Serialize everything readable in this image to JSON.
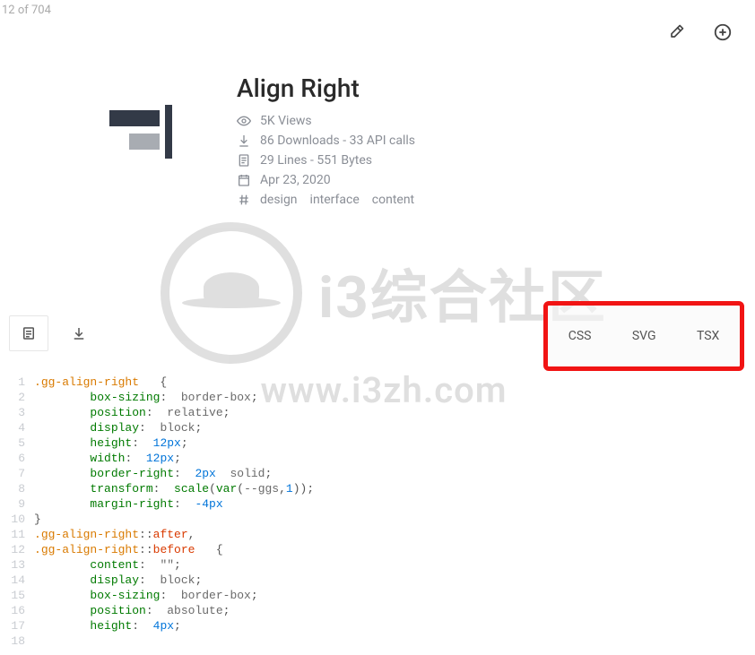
{
  "counter": "12 of 704",
  "header": {
    "title": "Align Right",
    "views": "5K Views",
    "downloads": "86 Downloads - 33 API calls",
    "lines": "29 Lines - 551 Bytes",
    "date": "Apr 23, 2020",
    "tags": [
      "design",
      "interface",
      "content"
    ]
  },
  "format_tabs": [
    "CSS",
    "SVG",
    "TSX"
  ],
  "watermark": {
    "label": "i3综合社区",
    "url": "www.i3zh.com"
  },
  "code": {
    "lines": [
      {
        "n": 1,
        "t": [
          [
            ".",
            "sel"
          ],
          [
            "gg-align-right",
            "sel"
          ],
          [
            "   {",
            "punct"
          ]
        ]
      },
      {
        "n": 2,
        "t": [
          [
            "        ",
            ""
          ],
          [
            "box-sizing",
            "prop"
          ],
          [
            ":  ",
            "punct"
          ],
          [
            "border-box",
            "val"
          ],
          [
            ";",
            "punct"
          ]
        ]
      },
      {
        "n": 3,
        "t": [
          [
            "        ",
            ""
          ],
          [
            "position",
            "prop"
          ],
          [
            ":  ",
            "punct"
          ],
          [
            "relative",
            "val"
          ],
          [
            ";",
            "punct"
          ]
        ]
      },
      {
        "n": 4,
        "t": [
          [
            "        ",
            ""
          ],
          [
            "display",
            "prop"
          ],
          [
            ":  ",
            "punct"
          ],
          [
            "block",
            "val"
          ],
          [
            ";",
            "punct"
          ]
        ]
      },
      {
        "n": 5,
        "t": [
          [
            "        ",
            ""
          ],
          [
            "height",
            "prop"
          ],
          [
            ":  ",
            "punct"
          ],
          [
            "12px",
            "num"
          ],
          [
            ";",
            "punct"
          ]
        ]
      },
      {
        "n": 6,
        "t": [
          [
            "        ",
            ""
          ],
          [
            "width",
            "prop"
          ],
          [
            ":  ",
            "punct"
          ],
          [
            "12px",
            "num"
          ],
          [
            ";",
            "punct"
          ]
        ]
      },
      {
        "n": 7,
        "t": [
          [
            "        ",
            ""
          ],
          [
            "border-right",
            "prop"
          ],
          [
            ":  ",
            "punct"
          ],
          [
            "2px",
            "num"
          ],
          [
            "  ",
            ""
          ],
          [
            "solid",
            "val"
          ],
          [
            ";",
            "punct"
          ]
        ]
      },
      {
        "n": 8,
        "t": [
          [
            "        ",
            ""
          ],
          [
            "transform",
            "prop"
          ],
          [
            ":  ",
            "punct"
          ],
          [
            "scale",
            "func"
          ],
          [
            "(",
            "punct"
          ],
          [
            "var",
            "func"
          ],
          [
            "(",
            "punct"
          ],
          [
            "--ggs",
            "val"
          ],
          [
            ",",
            "punct"
          ],
          [
            "1",
            "num"
          ],
          [
            "))",
            "punct"
          ],
          [
            ";",
            "punct"
          ]
        ]
      },
      {
        "n": 9,
        "t": [
          [
            "        ",
            ""
          ],
          [
            "margin-right",
            "prop"
          ],
          [
            ":  ",
            "punct"
          ],
          [
            "-4px",
            "num"
          ]
        ]
      },
      {
        "n": 10,
        "t": [
          [
            "}",
            "punct"
          ]
        ]
      },
      {
        "n": 11,
        "t": [
          [
            "",
            ""
          ]
        ]
      },
      {
        "n": 12,
        "t": [
          [
            ".",
            "sel"
          ],
          [
            "gg-align-right",
            "sel"
          ],
          [
            "::",
            "punct"
          ],
          [
            "after",
            "pseudo"
          ],
          [
            ",",
            "punct"
          ]
        ]
      },
      {
        "n": 13,
        "t": [
          [
            ".",
            "sel"
          ],
          [
            "gg-align-right",
            "sel"
          ],
          [
            "::",
            "punct"
          ],
          [
            "before",
            "pseudo"
          ],
          [
            "   {",
            "punct"
          ]
        ]
      },
      {
        "n": 14,
        "t": [
          [
            "        ",
            ""
          ],
          [
            "content",
            "prop"
          ],
          [
            ":  ",
            "punct"
          ],
          [
            "\"\"",
            "val"
          ],
          [
            ";",
            "punct"
          ]
        ]
      },
      {
        "n": 15,
        "t": [
          [
            "        ",
            ""
          ],
          [
            "display",
            "prop"
          ],
          [
            ":  ",
            "punct"
          ],
          [
            "block",
            "val"
          ],
          [
            ";",
            "punct"
          ]
        ]
      },
      {
        "n": 16,
        "t": [
          [
            "        ",
            ""
          ],
          [
            "box-sizing",
            "prop"
          ],
          [
            ":  ",
            "punct"
          ],
          [
            "border-box",
            "val"
          ],
          [
            ";",
            "punct"
          ]
        ]
      },
      {
        "n": 17,
        "t": [
          [
            "        ",
            ""
          ],
          [
            "position",
            "prop"
          ],
          [
            ":  ",
            "punct"
          ],
          [
            "absolute",
            "val"
          ],
          [
            ";",
            "punct"
          ]
        ]
      },
      {
        "n": 18,
        "t": [
          [
            "        ",
            ""
          ],
          [
            "height",
            "prop"
          ],
          [
            ":  ",
            "punct"
          ],
          [
            "4px",
            "num"
          ],
          [
            ";",
            "punct"
          ]
        ]
      }
    ]
  }
}
